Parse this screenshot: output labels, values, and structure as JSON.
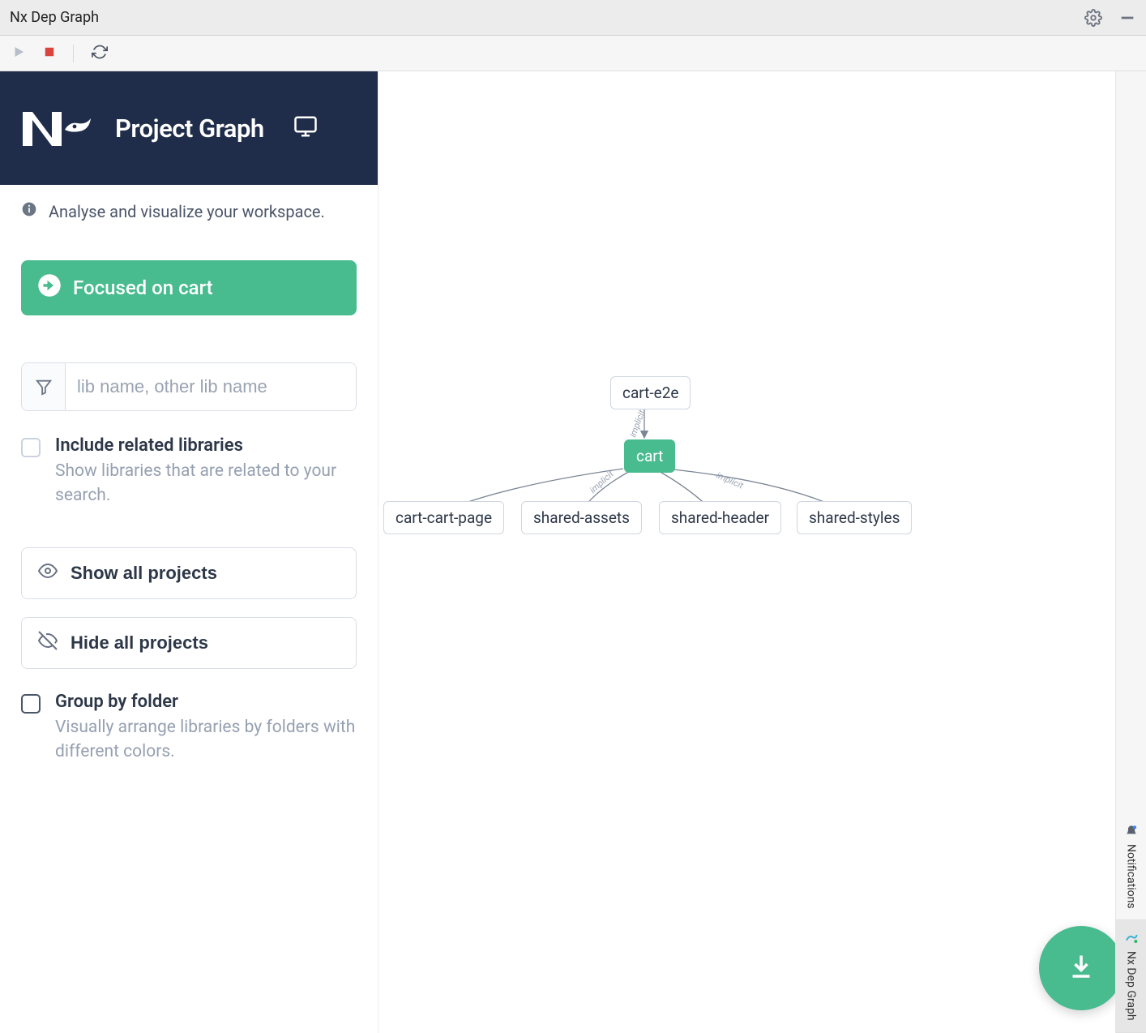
{
  "window": {
    "title": "Nx Dep Graph"
  },
  "sidebar": {
    "title": "Project Graph",
    "info": "Analyse and visualize your workspace.",
    "focus_label": "Focused on cart",
    "filter_placeholder": "lib name, other lib name",
    "include": {
      "title": "Include related libraries",
      "desc": "Show libraries that are related to your search."
    },
    "show_all": "Show all projects",
    "hide_all": "Hide all projects",
    "group": {
      "title": "Group by folder",
      "desc": "Visually arrange libraries by folders with different colors."
    }
  },
  "graph": {
    "nodes": {
      "e2e": "cart-e2e",
      "cart": "cart",
      "cart_page": "cart-cart-page",
      "shared_assets": "shared-assets",
      "shared_header": "shared-header",
      "shared_styles": "shared-styles"
    },
    "edge_labels": {
      "e2e_cart": "implicit",
      "cart_assets": "implicit",
      "cart_styles": "implicit"
    }
  },
  "rail": {
    "notifications": "Notifications",
    "graph": "Nx Dep Graph"
  }
}
